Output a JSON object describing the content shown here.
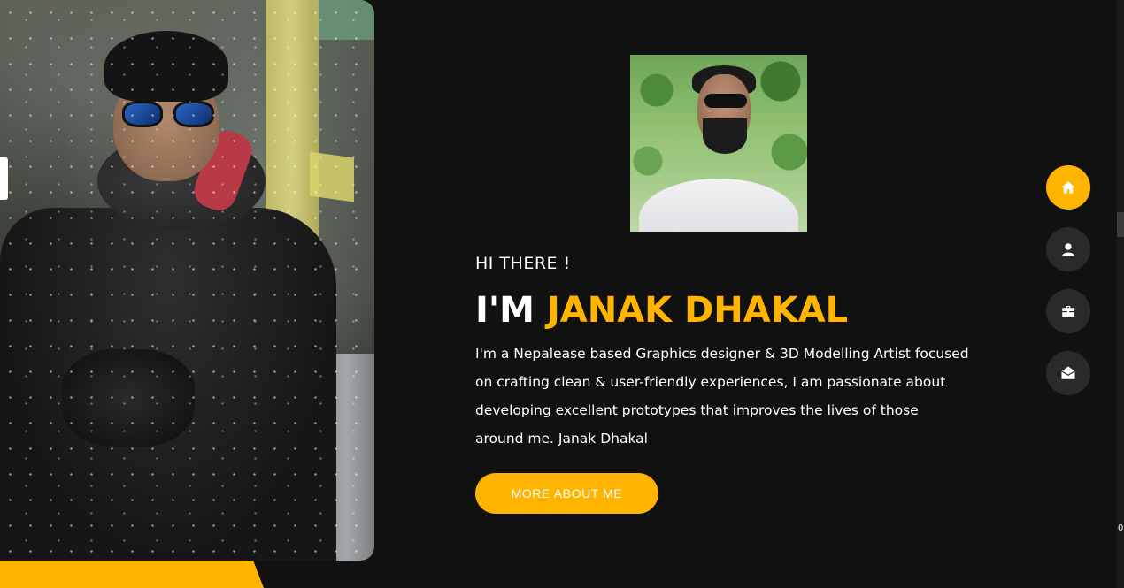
{
  "hero": {
    "greeting": "HI THERE !",
    "headline_prefix": "I'M",
    "name": "JANAK DHAKAL",
    "bio": "I'm a Nepalease based Graphics designer & 3D Modelling Artist focused on crafting clean & user-friendly experiences, I am passionate about developing excellent prototypes that improves the lives of those around me. Janak Dhakal",
    "cta_label": "MORE ABOUT ME"
  },
  "side_nav": [
    {
      "icon": "home-icon",
      "active": true
    },
    {
      "icon": "user-icon",
      "active": false
    },
    {
      "icon": "briefcase-icon",
      "active": false
    },
    {
      "icon": "envelope-open-icon",
      "active": false
    }
  ],
  "edge_text": "0",
  "colors": {
    "background": "#111111",
    "accent": "#ffb400",
    "nav_inactive": "#2b2a2a",
    "text": "#ffffff"
  }
}
